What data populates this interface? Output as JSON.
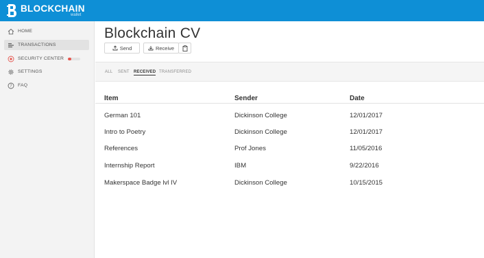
{
  "app": {
    "brand": "BLOCKCHAIN",
    "brand_sub": "wallet",
    "accent": "#0e8fd6"
  },
  "sidebar": {
    "items": [
      {
        "label": "HOME",
        "icon": "home-icon"
      },
      {
        "label": "TRANSACTIONS",
        "icon": "transactions-icon"
      },
      {
        "label": "SECURITY CENTER",
        "icon": "security-icon",
        "progress": 0.25,
        "progress_color": "#e5564f"
      },
      {
        "label": "SETTINGS",
        "icon": "gear-icon"
      },
      {
        "label": "FAQ",
        "icon": "help-icon"
      }
    ]
  },
  "main": {
    "title": "Blockchain CV",
    "buttons": {
      "send": "Send",
      "receive": "Receive",
      "clipboard_icon": "clipboard-icon"
    },
    "filters": [
      "ALL",
      "SENT",
      "RECEIVED",
      "TRANSFERRED"
    ],
    "active_filter": "RECEIVED",
    "table": {
      "columns": [
        "Item",
        "Sender",
        "Date"
      ],
      "rows": [
        [
          "German 101",
          "Dickinson College",
          "12/01/2017"
        ],
        [
          "Intro to Poetry",
          "Dickinson College",
          "12/01/2017"
        ],
        [
          "References",
          "Prof Jones",
          "11/05/2016"
        ],
        [
          "Internship Report",
          "IBM",
          "9/22/2016"
        ],
        [
          "Makerspace Badge lvl IV",
          "Dickinson College",
          "10/15/2015"
        ]
      ]
    }
  }
}
